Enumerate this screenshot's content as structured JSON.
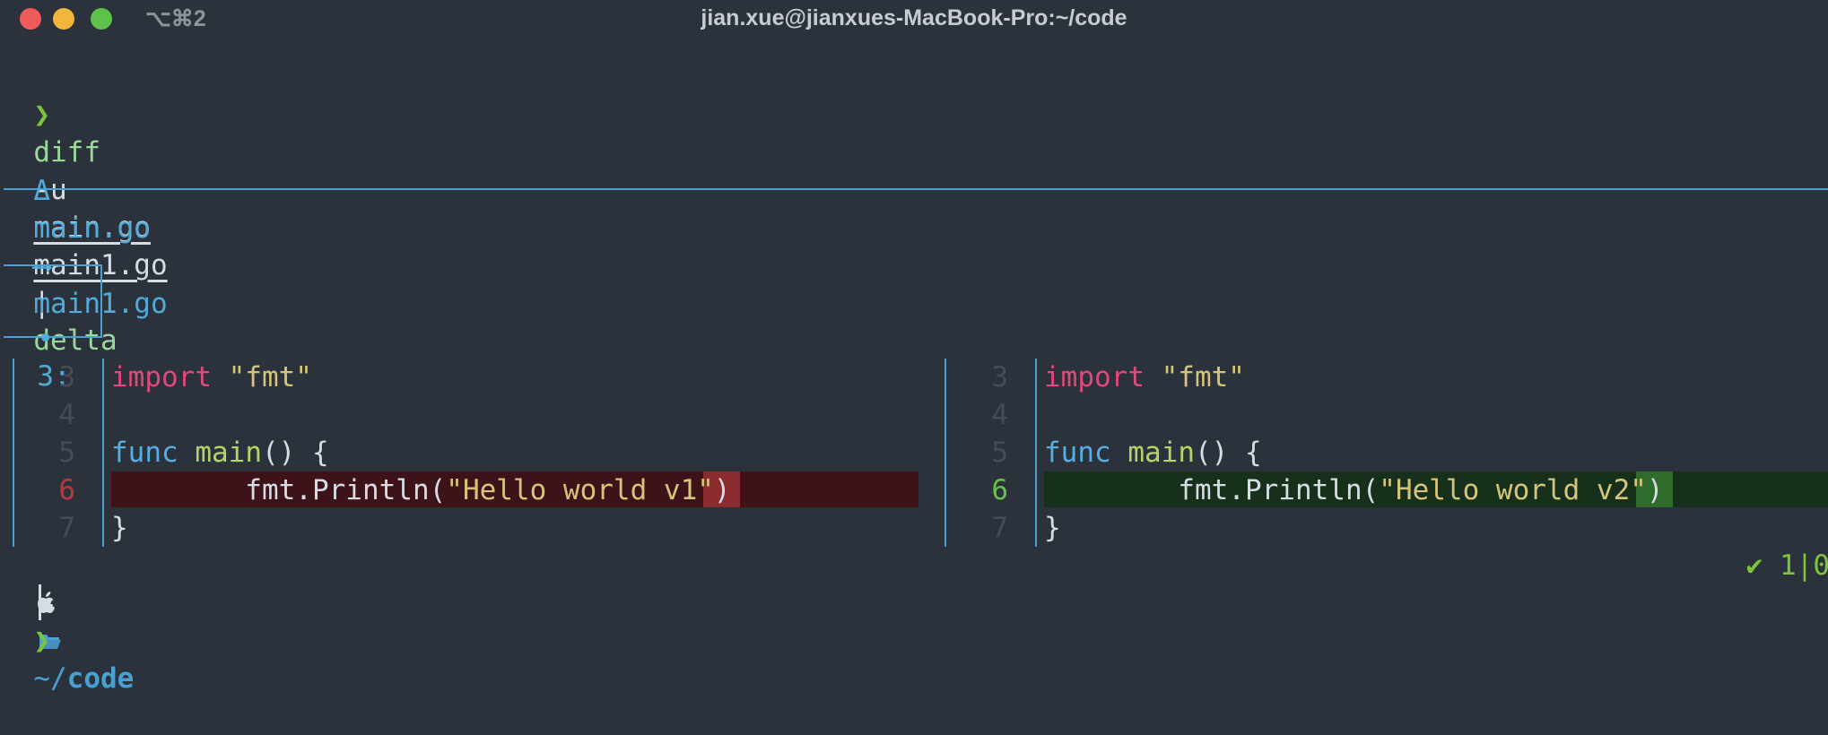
{
  "window": {
    "title": "jian.xue@jianxues-MacBook-Pro:~/code",
    "shortcut": "⌥⌘2"
  },
  "command": {
    "prompt": "❯",
    "diff": "diff",
    "flag": "-u",
    "file_a": "main.go",
    "file_b": "main1.go",
    "pipe": "|",
    "tool": "delta"
  },
  "file_header": {
    "delta": "Δ",
    "from": "main.go",
    "arrow": "⟶",
    "to": "main1.go"
  },
  "hunk": {
    "bullet": "•",
    "label": "3:"
  },
  "left_pane": {
    "lines": [
      {
        "num": "3",
        "kw": "import",
        "rest": " \"fmt\""
      },
      {
        "num": "4"
      },
      {
        "num": "5",
        "kw": "func",
        "name": "main",
        "rest": "() {"
      },
      {
        "num": "6",
        "prefix": "        fmt.Println(",
        "str1": "\"Hello world ",
        "hl": "v1",
        "str2": "\"",
        "suffix": ")"
      },
      {
        "num": "7",
        "rest": "}"
      }
    ]
  },
  "right_pane": {
    "lines": [
      {
        "num": "3",
        "kw": "import",
        "rest": " \"fmt\""
      },
      {
        "num": "4"
      },
      {
        "num": "5",
        "kw": "func",
        "name": "main",
        "rest": "() {"
      },
      {
        "num": "6",
        "prefix": "        fmt.Println(",
        "str1": "\"Hello world ",
        "hl": "v2",
        "str2": "\"",
        "suffix": ")"
      },
      {
        "num": "7",
        "rest": "}"
      }
    ]
  },
  "status": {
    "apple_icon": "apple-icon",
    "folder_icon": "folder-icon",
    "tilde": "~/",
    "dir": "code",
    "right": "✔ 1|0"
  },
  "colors": {
    "background": "#2b323c",
    "accent": "#4a9fd3",
    "minus_bg": "#3d1319",
    "plus_bg": "#17301c"
  }
}
